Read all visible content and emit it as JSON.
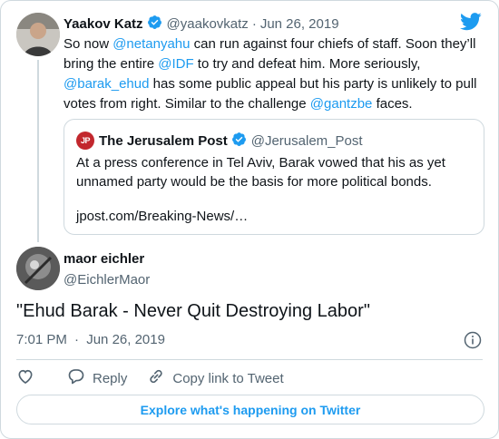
{
  "first_tweet": {
    "author_name": "Yaakov Katz",
    "author_handle": "@yaakovkatz",
    "separator": "·",
    "date": "Jun 26, 2019",
    "text": {
      "t1": "So now ",
      "m1": "@netanyahu",
      "t2": " can run against four chiefs of staff. Soon they’ll bring the entire ",
      "m2": "@IDF",
      "t3": " to try and defeat him. More seriously, ",
      "m3": "@barak_ehud",
      "t4": " has some public appeal but his party is unlikely to pull votes from right. Similar  to the challenge ",
      "m4": "@gantzbe",
      "t5": " faces."
    }
  },
  "quoted_tweet": {
    "avatar_text": "JP",
    "author_name": "The Jerusalem Post",
    "author_handle": "@Jerusalem_Post",
    "text": "At a press conference in Tel Aviv, Barak vowed that his as yet unnamed party would be the basis for more political bonds.",
    "link": "jpost.com/Breaking-News/…"
  },
  "main_tweet": {
    "author_name": "maor eichler",
    "author_handle": "@EichlerMaor",
    "text": "\"Ehud Barak - Never Quit Destroying Labor\"",
    "time": "7:01 PM",
    "separator": "·",
    "date": "Jun 26, 2019"
  },
  "actions": {
    "reply_label": "Reply",
    "copy_link_label": "Copy link to Tweet"
  },
  "explore_label": "Explore what's happening on Twitter",
  "colors": {
    "accent": "#1d9bf0",
    "text": "#0f1419",
    "muted": "#536471",
    "border": "#cfd9de",
    "jpost_red": "#c2272d"
  },
  "icons": [
    "verified-badge-icon",
    "twitter-bird-icon",
    "info-icon",
    "heart-icon",
    "reply-icon",
    "link-icon"
  ]
}
